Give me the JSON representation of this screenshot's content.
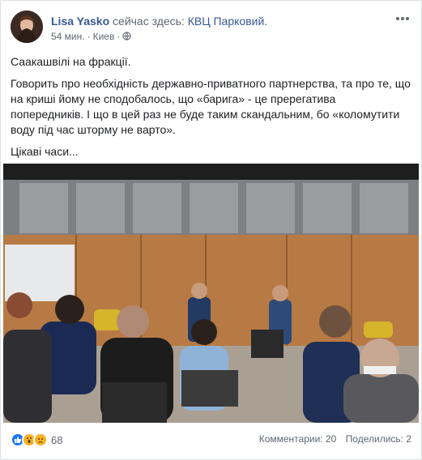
{
  "author": {
    "name": "Lisa Yasko",
    "action": "сейчас здесь:",
    "place": "КВЦ Парковий."
  },
  "meta": {
    "time": "54 мин.",
    "location": "Киев",
    "privacy_icon": "globe-icon"
  },
  "post": {
    "paragraphs": [
      "Саакашвілі на фракції.",
      "Говорить про необхідність державно-приватного партнерства, та про те, що на криші йому не сподобалось, що «барига» - це пререгатива попередників. І що в цей раз не буде таким скандальним, бо «коломутити воду під час шторму не варто».",
      "Цікаві часи..."
    ]
  },
  "reactions": {
    "icons": [
      "like-icon",
      "wow-icon",
      "sad-icon"
    ],
    "count": "68"
  },
  "stats": {
    "comments": "Комментарии: 20",
    "shares": "Поделились: 2"
  },
  "colors": {
    "link": "#385898",
    "secondary": "#616770",
    "like_blue": "#1877f2",
    "reaction_yellow": "#f7b125"
  }
}
